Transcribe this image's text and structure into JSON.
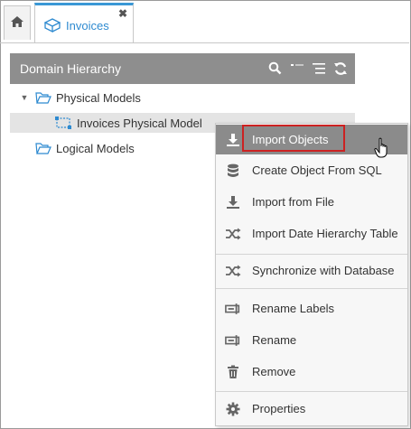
{
  "tabs": {
    "home_icon": "home-icon",
    "active_tab": {
      "label": "Invoices",
      "icon": "cube-icon",
      "close": "✖"
    }
  },
  "panel": {
    "title": "Domain Hierarchy",
    "tools": [
      "search-icon",
      "collapse-all-icon",
      "filter-list-icon",
      "refresh-icon"
    ]
  },
  "tree": {
    "items": [
      {
        "label": "Physical Models",
        "icon": "folder-open-icon",
        "expanded": true
      },
      {
        "label": "Invoices Physical Model",
        "icon": "physical-model-icon",
        "selected": true
      },
      {
        "label": "Logical Models",
        "icon": "folder-open-icon",
        "expanded": false
      }
    ]
  },
  "context_menu": {
    "items": [
      {
        "label": "Import Objects",
        "icon": "download-icon",
        "active": true
      },
      {
        "label": "Create Object From SQL",
        "icon": "database-icon"
      },
      {
        "label": "Import from File",
        "icon": "download-icon"
      },
      {
        "label": "Import Date Hierarchy Table",
        "icon": "shuffle-icon"
      },
      {
        "label": "Synchronize with Database",
        "icon": "shuffle-icon"
      },
      {
        "label": "Rename Labels",
        "icon": "rename-icon"
      },
      {
        "label": "Rename",
        "icon": "rename-icon"
      },
      {
        "label": "Remove",
        "icon": "trash-icon"
      },
      {
        "label": "Properties",
        "icon": "gear-icon"
      }
    ]
  },
  "colors": {
    "accent": "#3a98d6",
    "header_bg": "#8e8e8e",
    "active_item_bg": "#8b8b8b",
    "highlight_border": "#cc2222"
  }
}
